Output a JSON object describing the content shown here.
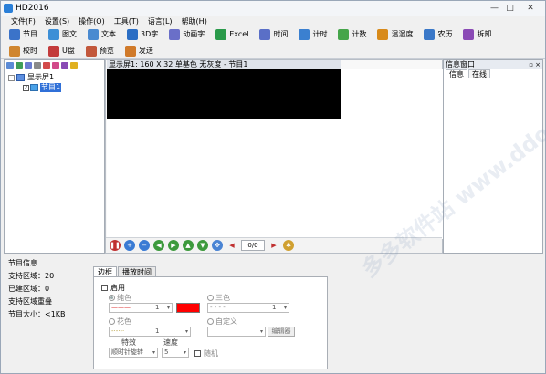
{
  "window": {
    "title": "HD2016"
  },
  "menu": [
    "文件(F)",
    "设置(S)",
    "操作(O)",
    "工具(T)",
    "语言(L)",
    "帮助(H)"
  ],
  "toolbar_row1": [
    {
      "label": "节目",
      "icon": "program-icon",
      "color": "#3b73c9"
    },
    {
      "label": "图文",
      "icon": "image-text-icon",
      "color": "#3d8fd6"
    },
    {
      "label": "文本",
      "icon": "text-icon",
      "color": "#4a8ad0"
    },
    {
      "label": "3D字",
      "icon": "3d-text-icon",
      "color": "#2b6ec4"
    },
    {
      "label": "动画字",
      "icon": "animated-text-icon",
      "color": "#6a6fc8"
    },
    {
      "label": "Excel",
      "icon": "excel-icon",
      "color": "#2a9a4a"
    },
    {
      "label": "时间",
      "icon": "clock-icon",
      "color": "#5a6fc7"
    },
    {
      "label": "计时",
      "icon": "timer-icon",
      "color": "#3b80d0"
    },
    {
      "label": "计数",
      "icon": "counter-icon",
      "color": "#45a54a"
    },
    {
      "label": "温湿度",
      "icon": "temperature-icon",
      "color": "#d88a1a"
    },
    {
      "label": "农历",
      "icon": "lunar-calendar-icon",
      "color": "#3a78c8"
    },
    {
      "label": "拆卸",
      "icon": "disassemble-icon",
      "color": "#8a4ab5"
    }
  ],
  "toolbar_row2": [
    {
      "label": "校时",
      "icon": "time-sync-icon",
      "color": "#d08630"
    },
    {
      "label": "U盘",
      "icon": "usb-drive-icon",
      "color": "#c33b3b"
    },
    {
      "label": "预览",
      "icon": "preview-icon",
      "color": "#c2573b"
    },
    {
      "label": "发送",
      "icon": "send-icon",
      "color": "#d07a2a"
    }
  ],
  "tree": {
    "root": "显示屏1",
    "child": "节目1"
  },
  "screen": {
    "caption": "显示屏1: 160 X 32  单基色 无灰度 - 节目1"
  },
  "playbar": {
    "counter": "0/0"
  },
  "info_panel": {
    "title": "信息窗口",
    "pin": "▫",
    "close": "×",
    "tabs": [
      "信息",
      "在线"
    ]
  },
  "program_info": {
    "title": "节目信息",
    "supported_areas": "支持区域：20",
    "created_areas": "已建区域：0",
    "overlap": "支持区域重叠",
    "size": "节目大小：<1KB"
  },
  "property_tabs": [
    "边框",
    "播放时间"
  ],
  "border": {
    "enable": "启用",
    "solid": "纯色",
    "tricolor": "三色",
    "pattern": "花色",
    "custom": "自定义",
    "edit": "编辑器",
    "effect_label": "特效",
    "speed_label": "速度",
    "effect_value": "顺时针旋转",
    "speed_value": "5",
    "random": "随机",
    "width1": "1",
    "width2": "1",
    "width3": "1",
    "swatch_color": "#ff0000"
  },
  "watermark": "多多软件站 www.ddooo.com"
}
